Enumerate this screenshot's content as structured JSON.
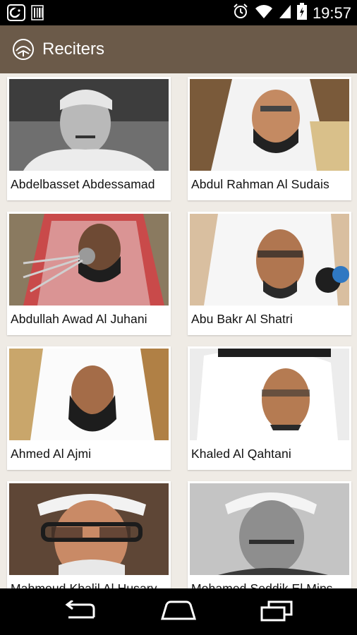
{
  "status_bar": {
    "time": "19:57"
  },
  "app_bar": {
    "title": "Reciters"
  },
  "reciters": [
    {
      "name": "Abdelbasset Abdessamad"
    },
    {
      "name": "Abdul Rahman Al Sudais"
    },
    {
      "name": "Abdullah Awad Al Juhani"
    },
    {
      "name": "Abu Bakr Al Shatri"
    },
    {
      "name": "Ahmed Al Ajmi"
    },
    {
      "name": "Khaled Al Qahtani"
    },
    {
      "name": "Mahmoud Khalil Al Husary"
    },
    {
      "name": "Mohamed Seddik El Minshawi"
    }
  ],
  "colors": {
    "app_bar": "#6b5a49",
    "background": "#efebe5",
    "card": "#ffffff"
  }
}
